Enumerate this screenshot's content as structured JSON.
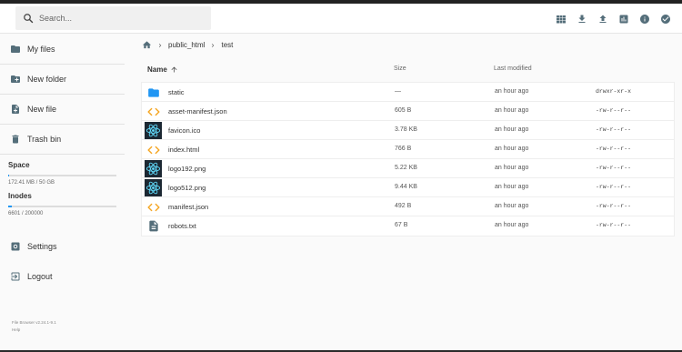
{
  "search": {
    "placeholder": "Search..."
  },
  "header": {
    "actions": [
      {
        "icon": "grid-view-icon",
        "label": "Switch view"
      },
      {
        "icon": "download-icon",
        "label": "Download"
      },
      {
        "icon": "upload-icon",
        "label": "Upload"
      },
      {
        "icon": "bar-chart-icon",
        "label": "Info"
      },
      {
        "icon": "info-icon",
        "label": "Info"
      },
      {
        "icon": "check-circle-icon",
        "label": "Select multiple"
      }
    ]
  },
  "sidebar": {
    "my_files": "My files",
    "new_folder": "New folder",
    "new_file": "New file",
    "trash_bin": "Trash bin",
    "space_title": "Space",
    "space_value": "172.41 MB / 50 GB",
    "space_fraction": 0.0034,
    "inodes_title": "Inodes",
    "inodes_value": "6601 / 200000",
    "inodes_fraction": 0.033,
    "settings": "Settings",
    "logout": "Logout",
    "version": "File Browser v2.24.1-9.1",
    "help": "Help"
  },
  "breadcrumb": [
    "public_html",
    "test"
  ],
  "columns": {
    "name": "Name",
    "size": "Size",
    "modified": "Last modified"
  },
  "files": [
    {
      "name": "static",
      "size": "—",
      "modified": "an hour ago",
      "perms": "drwxr-xr-x",
      "icon": "folder-icon"
    },
    {
      "name": "asset-manifest.json",
      "size": "605 B",
      "modified": "an hour ago",
      "perms": "-rw-r--r--",
      "icon": "code-icon"
    },
    {
      "name": "favicon.ico",
      "size": "3.78 KB",
      "modified": "an hour ago",
      "perms": "-rw-r--r--",
      "icon": "react-image-icon"
    },
    {
      "name": "index.html",
      "size": "766 B",
      "modified": "an hour ago",
      "perms": "-rw-r--r--",
      "icon": "code-icon"
    },
    {
      "name": "logo192.png",
      "size": "5.22 KB",
      "modified": "an hour ago",
      "perms": "-rw-r--r--",
      "icon": "react-image-icon"
    },
    {
      "name": "logo512.png",
      "size": "9.44 KB",
      "modified": "an hour ago",
      "perms": "-rw-r--r--",
      "icon": "react-image-icon"
    },
    {
      "name": "manifest.json",
      "size": "492 B",
      "modified": "an hour ago",
      "perms": "-rw-r--r--",
      "icon": "code-icon"
    },
    {
      "name": "robots.txt",
      "size": "67 B",
      "modified": "an hour ago",
      "perms": "-rw-r--r--",
      "icon": "document-icon"
    }
  ],
  "colors": {
    "accent": "#2196f3",
    "folder": "#2196f3",
    "code": "#f5a623",
    "react_bg": "#1c2833",
    "react": "#61dafb",
    "icon_gray": "#546e7a"
  }
}
